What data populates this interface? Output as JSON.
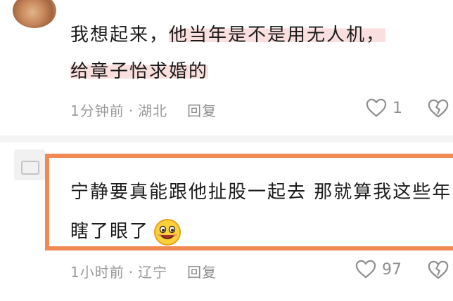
{
  "comments": [
    {
      "username": "",
      "text_plain": "我想起来，",
      "text_highlight_1": "他当年是不是用无人机，",
      "text_highlight_2": "给章子怡求婚的",
      "time": "1分钟前",
      "location": "湖北",
      "reply_label": "回复",
      "likes": "1"
    },
    {
      "text": "宁静要真能跟他扯股一起去 那就算我这些年瞎了眼了",
      "time": "1小时前",
      "location": "辽宁",
      "reply_label": "回复",
      "likes": "97",
      "emoji": "grin-emoji"
    }
  ],
  "meta_separator": "·",
  "colors": {
    "highlight": "#f9e0de",
    "box_border": "#f08a55",
    "meta_text": "#9a9a9a"
  }
}
